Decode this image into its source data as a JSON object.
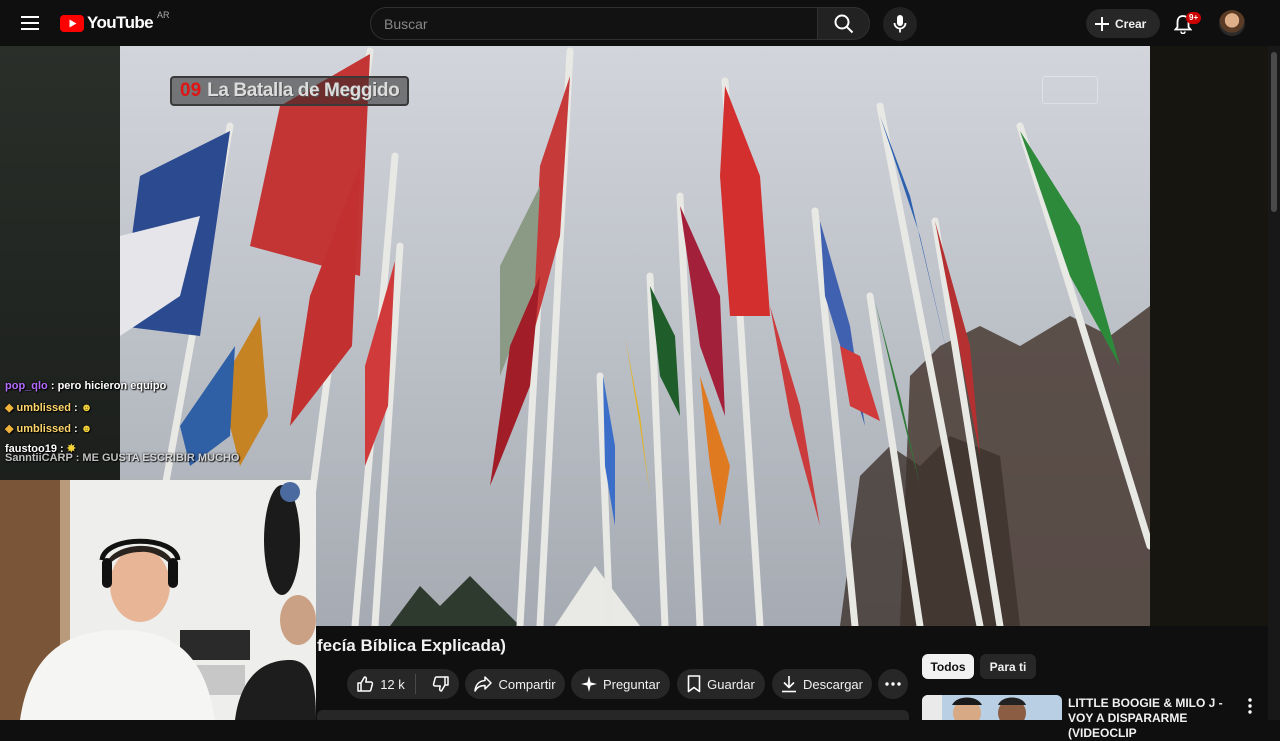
{
  "header": {
    "logo_text": "YouTube",
    "country_code": "AR",
    "search_placeholder": "Buscar",
    "create_label": "Crear",
    "notifications_badge": "9+"
  },
  "video": {
    "chapter_number": "09",
    "chapter_title": "La Batalla de Meggido",
    "title": "fecía Bíblica Explicada)"
  },
  "chat": {
    "messages": [
      {
        "user": "pop_qlo",
        "text": ": pero hicieron equipo",
        "color": "#b46cff"
      },
      {
        "user": "umblissed",
        "text": ":",
        "color": "#ffd66b"
      },
      {
        "user": "umblissed",
        "text": ":",
        "color": "#ffd66b"
      },
      {
        "user": "faustoo19",
        "text": ":",
        "color": "#ffffff"
      },
      {
        "user": "SanntiiCARP",
        "text": ": ME GUSTA ESCRIBIR MUCHO",
        "color": "#ffffff"
      }
    ]
  },
  "actions": {
    "like_count": "12 k",
    "share": "Compartir",
    "ask": "Preguntar",
    "save": "Guardar",
    "download": "Descargar"
  },
  "recommendations": {
    "chips": [
      "Todos",
      "Para ti"
    ],
    "items": [
      {
        "title": "LITTLE BOOGIE & MILO J - VOY A DISPARARME (VIDEOCLIP"
      }
    ]
  },
  "colors": {
    "background": "#0f0f0f",
    "accent_red": "#ff0000",
    "chip_bg": "#272727"
  }
}
